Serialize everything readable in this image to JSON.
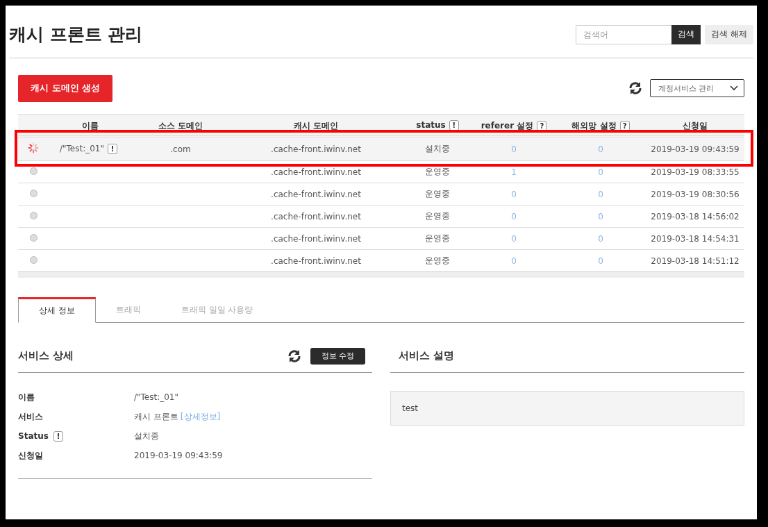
{
  "page": {
    "title": "캐시 프론트 관리"
  },
  "search": {
    "placeholder": "검색어",
    "button": "검색",
    "clear_button": "검색 해제"
  },
  "toolbar": {
    "create_button": "캐시 도메인 생성",
    "service_select": "계정서비스 관리"
  },
  "table": {
    "columns": [
      {
        "label": "이름"
      },
      {
        "label": "소스 도메인"
      },
      {
        "label": "캐시 도메인"
      },
      {
        "label": "status",
        "badge": "!"
      },
      {
        "label": "referer 설정",
        "badge": "?"
      },
      {
        "label": "해외망 설정",
        "badge": "?"
      },
      {
        "label": "신청일"
      }
    ],
    "rows": [
      {
        "kind": "installing",
        "selected": true,
        "name": "/\"Test:_01\"",
        "name_badge": "!",
        "source_domain": ".com",
        "cache_domain": ".cache-front.iwinv.net",
        "status": "설치중",
        "referer": "0",
        "overseas": "0",
        "date": "2019-03-19 09:43:59"
      },
      {
        "kind": "running",
        "selected": false,
        "cache_domain": ".cache-front.iwinv.net",
        "status": "운영중",
        "referer": "1",
        "overseas": "0",
        "date": "2019-03-19 08:33:55"
      },
      {
        "kind": "running",
        "selected": false,
        "cache_domain": ".cache-front.iwinv.net",
        "status": "운영중",
        "referer": "0",
        "overseas": "0",
        "date": "2019-03-19 08:30:56"
      },
      {
        "kind": "running",
        "selected": false,
        "cache_domain": ".cache-front.iwinv.net",
        "status": "운영중",
        "referer": "0",
        "overseas": "0",
        "date": "2019-03-18 14:56:02"
      },
      {
        "kind": "running",
        "selected": false,
        "cache_domain": ".cache-front.iwinv.net",
        "status": "운영중",
        "referer": "0",
        "overseas": "0",
        "date": "2019-03-18 14:54:31"
      },
      {
        "kind": "running",
        "selected": false,
        "cache_domain": ".cache-front.iwinv.net",
        "status": "운영중",
        "referer": "0",
        "overseas": "0",
        "date": "2019-03-18 14:51:12"
      }
    ]
  },
  "tabs": [
    {
      "label": "상세 정보",
      "selected": true
    },
    {
      "label": "트래픽",
      "selected": false
    },
    {
      "label": "트래픽 일일 사용량",
      "selected": false
    }
  ],
  "service_detail": {
    "title": "서비스 상세",
    "edit_button": "정보 수정",
    "fields": [
      {
        "label": "이름",
        "value": "/\"Test:_01\""
      },
      {
        "label": "서비스",
        "value": "캐시 프론트",
        "link": "[상세정보]"
      },
      {
        "label": "Status",
        "badge": "!",
        "value": "설치중"
      },
      {
        "label": "신청일",
        "value": "2019-03-19 09:43:59"
      }
    ]
  },
  "service_description": {
    "title": "서비스 설명",
    "text": "test"
  }
}
